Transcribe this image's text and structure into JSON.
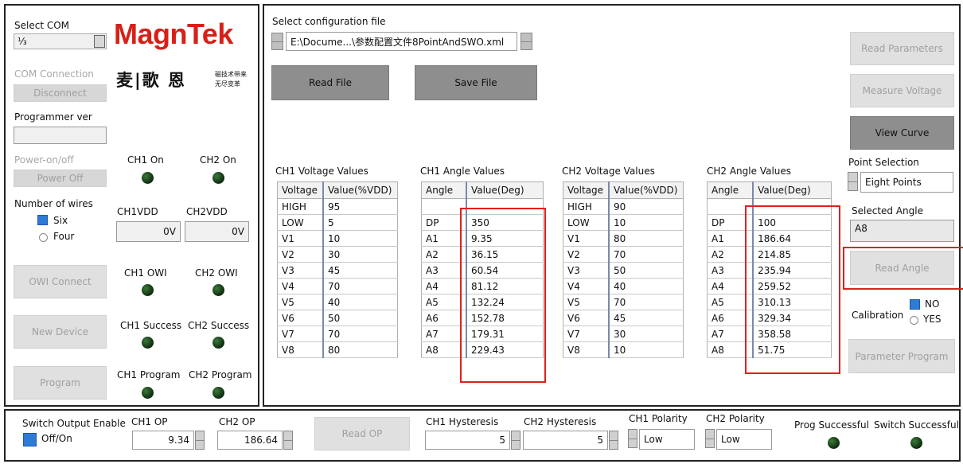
{
  "left": {
    "select_com_label": "Select COM",
    "com_value": "⅓",
    "com_connection_label": "COM Connection",
    "disconnect_button": "Disconnect",
    "programmer_ver_label": "Programmer ver",
    "programmer_ver_value": "",
    "power_label": "Power-on/off",
    "power_off_button": "Power Off",
    "wires_label": "Number of wires",
    "six_label": "Six",
    "four_label": "Four",
    "owi_connect_button": "OWI Connect",
    "new_device_button": "New Device",
    "program_button": "Program"
  },
  "logo": {
    "brand": "MagnTek",
    "chinese_name": "麦|歌 恩",
    "slogan_line1": "磁技术带来",
    "slogan_line2": "无尽变革",
    "brand_color": "#d62118"
  },
  "channels": {
    "ch1_on": "CH1 On",
    "ch2_on": "CH2 On",
    "ch1vdd_label": "CH1VDD",
    "ch2vdd_label": "CH2VDD",
    "ch1vdd_value": "0V",
    "ch2vdd_value": "0V",
    "ch1_owi": "CH1 OWI",
    "ch2_owi": "CH2 OWI",
    "ch1_success": "CH1 Success",
    "ch2_success": "CH2 Success",
    "ch1_program": "CH1 Program",
    "ch2_program": "CH2 Program"
  },
  "config": {
    "select_file_label": "Select configuration file",
    "file_path": "E:\\Docume...\\参数配置文件8PointAndSWO.xml",
    "read_file_button": "Read File",
    "save_file_button": "Save File"
  },
  "tables": {
    "ch1_voltage": {
      "title": "CH1 Voltage Values",
      "headers": [
        "Voltage",
        "Value(%VDD)"
      ],
      "rows": [
        [
          "HIGH",
          "95"
        ],
        [
          "LOW",
          "5"
        ],
        [
          "V1",
          "10"
        ],
        [
          "V2",
          "30"
        ],
        [
          "V3",
          "45"
        ],
        [
          "V4",
          "70"
        ],
        [
          "V5",
          "40"
        ],
        [
          "V6",
          "50"
        ],
        [
          "V7",
          "70"
        ],
        [
          "V8",
          "80"
        ]
      ]
    },
    "ch1_angle": {
      "title": "CH1 Angle Values",
      "headers": [
        "Angle",
        "Value(Deg)"
      ],
      "rows": [
        [
          "",
          ""
        ],
        [
          "DP",
          "350"
        ],
        [
          "A1",
          "9.35"
        ],
        [
          "A2",
          "36.15"
        ],
        [
          "A3",
          "60.54"
        ],
        [
          "A4",
          "81.12"
        ],
        [
          "A5",
          "132.24"
        ],
        [
          "A6",
          "152.78"
        ],
        [
          "A7",
          "179.31"
        ],
        [
          "A8",
          "229.43"
        ]
      ]
    },
    "ch2_voltage": {
      "title": "CH2 Voltage Values",
      "headers": [
        "Voltage",
        "Value(%VDD)"
      ],
      "rows": [
        [
          "HIGH",
          "90"
        ],
        [
          "LOW",
          "10"
        ],
        [
          "V1",
          "80"
        ],
        [
          "V2",
          "70"
        ],
        [
          "V3",
          "50"
        ],
        [
          "V4",
          "40"
        ],
        [
          "V5",
          "70"
        ],
        [
          "V6",
          "45"
        ],
        [
          "V7",
          "30"
        ],
        [
          "V8",
          "10"
        ]
      ]
    },
    "ch2_angle": {
      "title": "CH2 Angle Values",
      "headers": [
        "Angle",
        "Value(Deg)"
      ],
      "rows": [
        [
          "",
          ""
        ],
        [
          "DP",
          "100"
        ],
        [
          "A1",
          "186.64"
        ],
        [
          "A2",
          "214.85"
        ],
        [
          "A3",
          "235.94"
        ],
        [
          "A4",
          "259.52"
        ],
        [
          "A5",
          "310.13"
        ],
        [
          "A6",
          "329.34"
        ],
        [
          "A7",
          "358.58"
        ],
        [
          "A8",
          "51.75"
        ]
      ]
    }
  },
  "right": {
    "read_parameters_button": "Read Parameters",
    "measure_voltage_button": "Measure  Voltage",
    "view_curve_button": "View Curve",
    "point_selection_label": "Point Selection",
    "point_selection_value": "Eight Points",
    "selected_angle_label": "Selected Angle",
    "selected_angle_value": "A8",
    "read_angle_button": "Read  Angle",
    "calibration_label": "Calibration",
    "no_label": "NO",
    "yes_label": "YES",
    "parameter_program_button": "Parameter Program"
  },
  "bottom": {
    "switch_output_label": "Switch Output Enable",
    "off_on_label": "Off/On",
    "ch1_op_label": "CH1 OP",
    "ch1_op_value": "9.34",
    "ch2_op_label": "CH2 OP",
    "ch2_op_value": "186.64",
    "read_op_button": "Read OP",
    "ch1_hyst_label": "CH1 Hysteresis",
    "ch1_hyst_value": "5",
    "ch2_hyst_label": "CH2 Hysteresis",
    "ch2_hyst_value": "5",
    "ch1_polarity_label": "CH1 Polarity",
    "ch1_polarity_value": "Low",
    "ch2_polarity_label": "CH2 Polarity",
    "ch2_polarity_value": "Low",
    "prog_successful_label": "Prog Successful",
    "switch_successful_label": "Switch Successful"
  },
  "colors": {
    "highlight_red": "#e0201c",
    "checkbox_blue": "#2e7bd6",
    "led_green": "#1f4f1f"
  }
}
